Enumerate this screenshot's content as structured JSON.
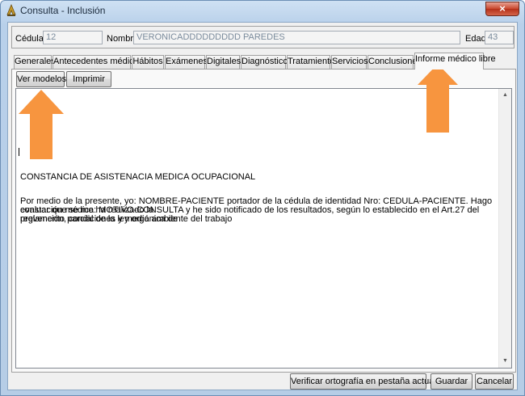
{
  "window": {
    "title": "Consulta - Inclusión",
    "close_label": "×"
  },
  "patient": {
    "cedula_label": "Cédula",
    "cedula_value": "12",
    "nombre_label": "Nombre",
    "nombre_value": "VERONICADDDDDDDDD PAREDES",
    "edad_label": "Edad",
    "edad_value": "43"
  },
  "tabs": [
    {
      "label": "Generales"
    },
    {
      "label": "Antecedentes médicos"
    },
    {
      "label": "Hábitos"
    },
    {
      "label": "Exámenes"
    },
    {
      "label": "Digitales"
    },
    {
      "label": "Diagnóstico"
    },
    {
      "label": "Tratamiento"
    },
    {
      "label": "Servicios"
    },
    {
      "label": "Conclusiones"
    },
    {
      "label": "Informe médico libre"
    }
  ],
  "toolbar": {
    "ver_modelos_label": "Ver modelos",
    "imprimir_label": "Imprimir"
  },
  "document": {
    "heading": "CONSTANCIA DE ASISTENACIA MEDICA OCUPACIONAL",
    "line1": "Por medio de la presente, yo: NOMBRE-PACIENTE portador de la cédula de identidad Nro: CEDULA-PACIENTE. Hago constar que se me ha realizado la",
    "line2": "evaluación médica: MOTIVO-CONSULTA y he sido notificado de los resultados, según lo establecido en el Art.27 del reglamento parcial de la ley orgánica de",
    "line3": "prevención, condiciones y medio ambiente del trabajo"
  },
  "footer": {
    "spellcheck_label": "Verificar ortografía en pestaña actual",
    "save_label": "Guardar",
    "cancel_label": "Cancelar"
  },
  "colors": {
    "annotation_arrow": "#f7953f",
    "title_bar": "#b8d0ea",
    "close_button": "#c8452c"
  },
  "icons": {
    "title": "app-icon",
    "scroll_up": "scroll-up-arrow-icon",
    "scroll_down": "scroll-down-arrow-icon"
  }
}
